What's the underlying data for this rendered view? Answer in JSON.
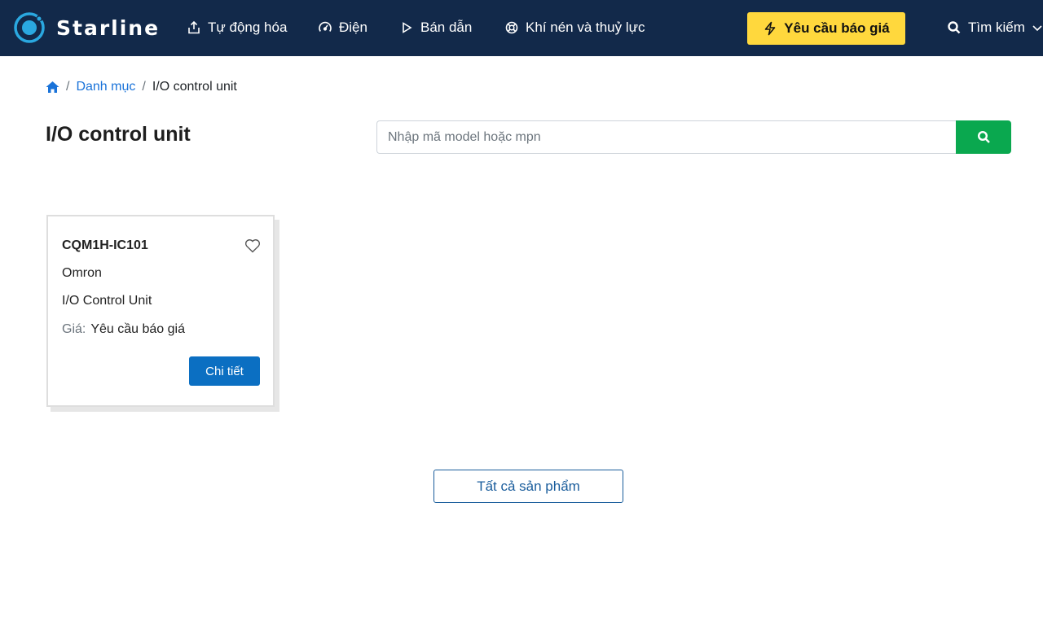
{
  "nav": {
    "brand_name": "Starline",
    "items": [
      {
        "label": "Tự động hóa",
        "icon": "upload-icon"
      },
      {
        "label": "Điện",
        "icon": "gauge-icon"
      },
      {
        "label": "Bán dẫn",
        "icon": "play-icon"
      },
      {
        "label": "Khí nén và thuỷ lực",
        "icon": "lifebuoy-icon"
      }
    ],
    "quote_label": "Yêu cầu báo giá",
    "search_label": "Tìm kiếm"
  },
  "breadcrumb": {
    "category": "Danh mục",
    "current": "I/O control unit"
  },
  "page": {
    "title": "I/O control unit"
  },
  "search": {
    "placeholder": "Nhập mã model hoặc mpn",
    "value": ""
  },
  "products": [
    {
      "model": "CQM1H-IC101",
      "brand": "Omron",
      "type": "I/O Control Unit",
      "price_label": "Giá:",
      "price": "Yêu cầu báo giá",
      "detail_label": "Chi tiết"
    }
  ],
  "all_products_label": "Tất cả sản phẩm",
  "colors": {
    "navbar_bg": "#12294a",
    "quote_bg": "#ffd83d",
    "search_btn_bg": "#0aa84f",
    "detail_btn_bg": "#0b6fc2",
    "link": "#1a73d9"
  }
}
